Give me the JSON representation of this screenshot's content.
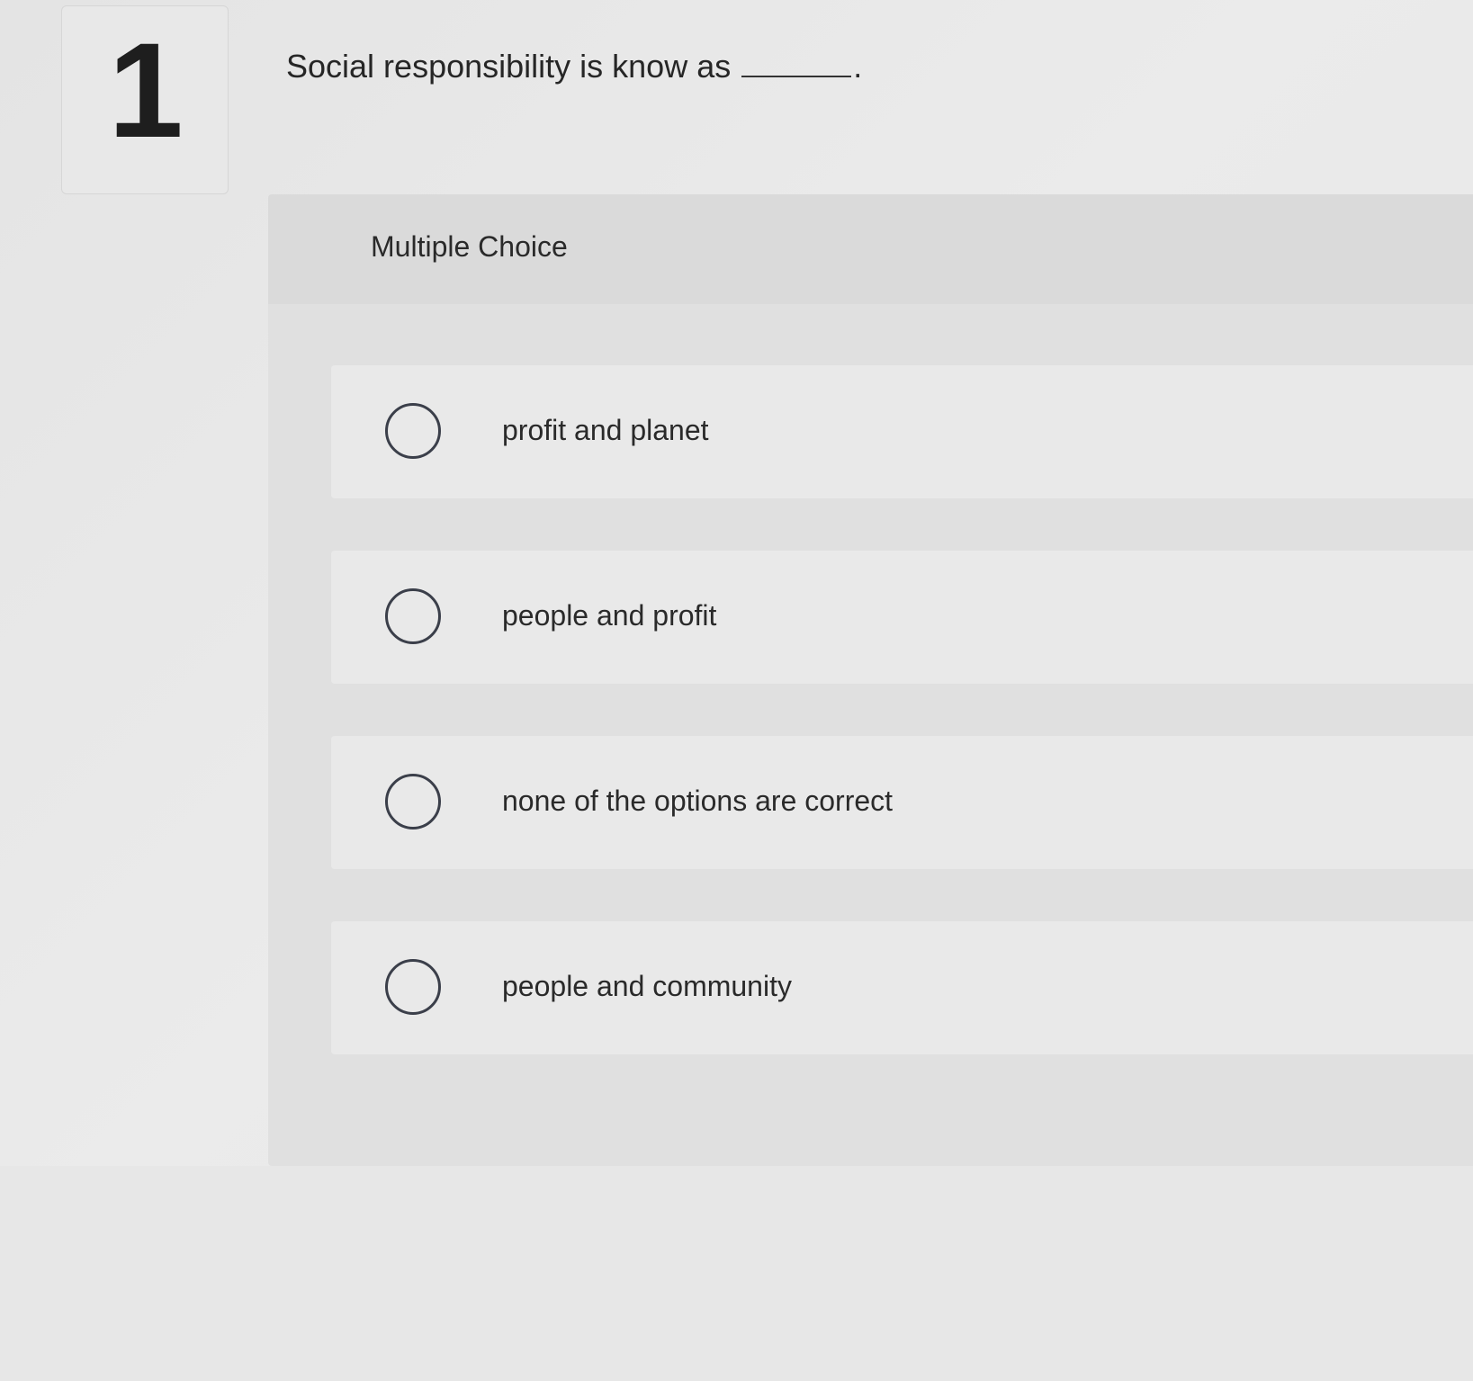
{
  "question": {
    "number": "1",
    "prompt": "Social responsibility is know as",
    "prompt_end": "."
  },
  "panel": {
    "title": "Multiple Choice"
  },
  "options": [
    {
      "label": "profit and planet"
    },
    {
      "label": "people and profit"
    },
    {
      "label": "none of the options are correct"
    },
    {
      "label": "people and community"
    }
  ]
}
